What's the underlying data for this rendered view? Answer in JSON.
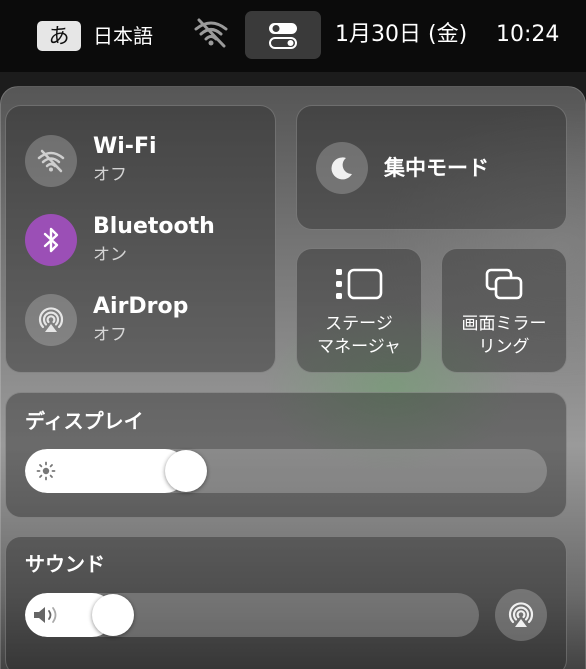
{
  "menubar": {
    "ime_glyph": "あ",
    "ime_label": "日本語",
    "date": "1月30日 (金)",
    "time": "10:24",
    "icons": {
      "wifi": "wifi-off-icon",
      "control_center": "control-center-icon"
    }
  },
  "control_center": {
    "network": [
      {
        "name": "Wi-Fi",
        "status": "オフ",
        "icon": "wifi-off-icon",
        "active": false
      },
      {
        "name": "Bluetooth",
        "status": "オン",
        "icon": "bluetooth-icon",
        "active": true
      },
      {
        "name": "AirDrop",
        "status": "オフ",
        "icon": "airdrop-icon",
        "active": false
      }
    ],
    "focus": {
      "label": "集中モード",
      "icon": "moon-icon"
    },
    "stage_manager": {
      "line1": "ステージ",
      "line2": "マネージャ",
      "icon": "stage-manager-icon"
    },
    "screen_mirroring": {
      "line1": "画面ミラー",
      "line2": "リング",
      "icon": "screen-mirroring-icon"
    },
    "display": {
      "label": "ディスプレイ",
      "brightness": 0.29,
      "icon": "sun-icon"
    },
    "sound": {
      "label": "サウンド",
      "volume": 0.16,
      "icon": "speaker-icon",
      "output_icon": "airplay-audio-icon"
    }
  },
  "colors": {
    "bluetooth_active": "#9b4fb6",
    "menubar_bg": "#0b0b0b"
  }
}
